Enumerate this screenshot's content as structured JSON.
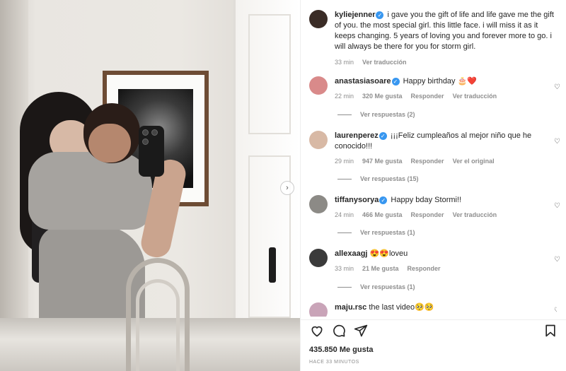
{
  "post": {
    "author": {
      "username": "kyliejenner",
      "verified": true
    },
    "caption": "i gave you the gift of life and life gave me the gift of you. the most special girl. this little face. i will miss it as it keeps changing. 5 years of loving you and forever more to go. i will always be there for you for storm girl.",
    "caption_time": "33 min",
    "caption_translate": "Ver traducción",
    "likes": "435.850 Me gusta",
    "posted_ago": "HACE 33 MINUTOS"
  },
  "comments": [
    {
      "username": "anastasiasoare",
      "verified": true,
      "text": "Happy birthday 🎂❤️",
      "time": "22 min",
      "likes": "320 Me gusta",
      "reply": "Responder",
      "extra": "Ver traducción",
      "replies": "Ver respuestas (2)",
      "avatar_color": "#d98a8a"
    },
    {
      "username": "laurenperez",
      "verified": true,
      "text": "¡¡¡Feliz cumpleaños al mejor niño que he conocido!!!",
      "time": "29 min",
      "likes": "947 Me gusta",
      "reply": "Responder",
      "extra": "Ver el original",
      "replies": "Ver respuestas (15)",
      "avatar_color": "#d8b9a5"
    },
    {
      "username": "tiffanysorya",
      "verified": true,
      "text": "Happy bday Stormi!!",
      "time": "24 min",
      "likes": "466 Me gusta",
      "reply": "Responder",
      "extra": "Ver traducción",
      "replies": "Ver respuestas (1)",
      "avatar_color": "#8c8a86"
    },
    {
      "username": "allexaagj",
      "verified": false,
      "text": "😍😍loveu",
      "time": "33 min",
      "likes": "21 Me gusta",
      "reply": "Responder",
      "extra": "",
      "replies": "Ver respuestas (1)",
      "avatar_color": "#3a3a3a"
    },
    {
      "username": "maju.rsc",
      "verified": false,
      "text": "the last video🥺🥺",
      "avatar_color": "#c9a4b8"
    }
  ],
  "icons": {
    "like": "heart-outline-icon",
    "comment": "speech-bubble-icon",
    "share": "paper-plane-icon",
    "save": "bookmark-icon",
    "next": "chevron-right-icon"
  },
  "colors": {
    "verified": "#3897f0",
    "muted": "#8e8e8e",
    "text": "#262626"
  }
}
